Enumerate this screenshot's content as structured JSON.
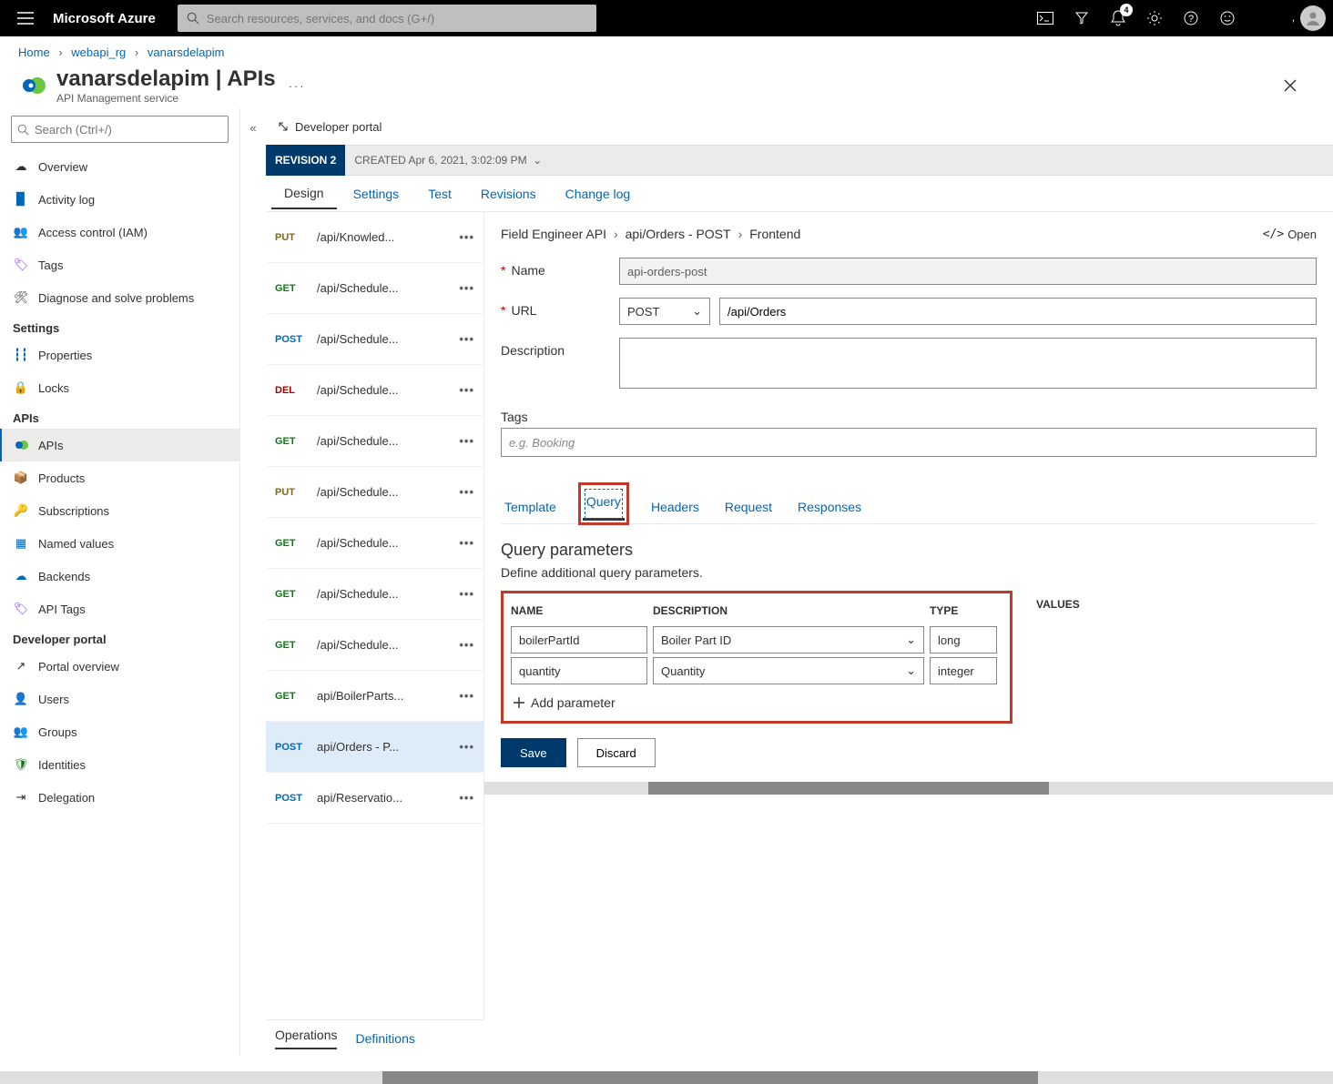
{
  "brand": "Microsoft Azure",
  "search_placeholder": "Search resources, services, and docs (G+/)",
  "notif_count": "4",
  "breadcrumb": {
    "home": "Home",
    "rg": "webapi_rg",
    "res": "vanarsdelapim"
  },
  "page": {
    "title": "vanarsdelapim | APIs",
    "subtitle": "API Management service"
  },
  "nav_search_placeholder": "Search (Ctrl+/)",
  "nav": {
    "overview": "Overview",
    "activity": "Activity log",
    "access": "Access control (IAM)",
    "tags": "Tags",
    "diag": "Diagnose and solve problems",
    "grp_settings": "Settings",
    "properties": "Properties",
    "locks": "Locks",
    "grp_apis": "APIs",
    "apis": "APIs",
    "products": "Products",
    "subs": "Subscriptions",
    "named": "Named values",
    "backends": "Backends",
    "apitags": "API Tags",
    "grp_dev": "Developer portal",
    "portal_ov": "Portal overview",
    "users": "Users",
    "groups": "Groups",
    "identities": "Identities",
    "delegation": "Delegation"
  },
  "dev_portal_link": "Developer portal",
  "revision": {
    "badge": "REVISION 2",
    "created": "CREATED Apr 6, 2021, 3:02:09 PM"
  },
  "subtabs": {
    "design": "Design",
    "settings": "Settings",
    "test": "Test",
    "revisions": "Revisions",
    "changelog": "Change log"
  },
  "ops": [
    {
      "method": "PUT",
      "cls": "m-put",
      "path": "/api/Knowled..."
    },
    {
      "method": "GET",
      "cls": "m-get",
      "path": "/api/Schedule..."
    },
    {
      "method": "POST",
      "cls": "m-post",
      "path": "/api/Schedule..."
    },
    {
      "method": "DEL",
      "cls": "m-del",
      "path": "/api/Schedule..."
    },
    {
      "method": "GET",
      "cls": "m-get",
      "path": "/api/Schedule..."
    },
    {
      "method": "PUT",
      "cls": "m-put",
      "path": "/api/Schedule..."
    },
    {
      "method": "GET",
      "cls": "m-get",
      "path": "/api/Schedule..."
    },
    {
      "method": "GET",
      "cls": "m-get",
      "path": "/api/Schedule..."
    },
    {
      "method": "GET",
      "cls": "m-get",
      "path": "/api/Schedule..."
    },
    {
      "method": "GET",
      "cls": "m-get",
      "path": "api/BoilerParts..."
    },
    {
      "method": "POST",
      "cls": "m-post",
      "path": "api/Orders - P...",
      "sel": true
    },
    {
      "method": "POST",
      "cls": "m-post",
      "path": "api/Reservatio..."
    }
  ],
  "bottomtabs": {
    "operations": "Operations",
    "definitions": "Definitions"
  },
  "detail": {
    "crumb1": "Field Engineer API",
    "crumb2": "api/Orders - POST",
    "crumb3": "Frontend",
    "open_label": "Open",
    "name_lbl": "Name",
    "name_val": "api-orders-post",
    "url_lbl": "URL",
    "url_method": "POST",
    "url_val": "/api/Orders",
    "desc_lbl": "Description",
    "tags_lbl": "Tags",
    "tags_placeholder": "e.g. Booking",
    "tabs": {
      "template": "Template",
      "query": "Query",
      "headers": "Headers",
      "request": "Request",
      "responses": "Responses"
    },
    "sect_title": "Query parameters",
    "sect_sub": "Define additional query parameters.",
    "th": {
      "name": "NAME",
      "desc": "DESCRIPTION",
      "type": "TYPE",
      "values": "VALUES"
    },
    "rows": [
      {
        "name": "boilerPartId",
        "desc": "Boiler Part ID",
        "type": "long"
      },
      {
        "name": "quantity",
        "desc": "Quantity",
        "type": "integer"
      }
    ],
    "add_param": "Add parameter",
    "save": "Save",
    "discard": "Discard"
  }
}
